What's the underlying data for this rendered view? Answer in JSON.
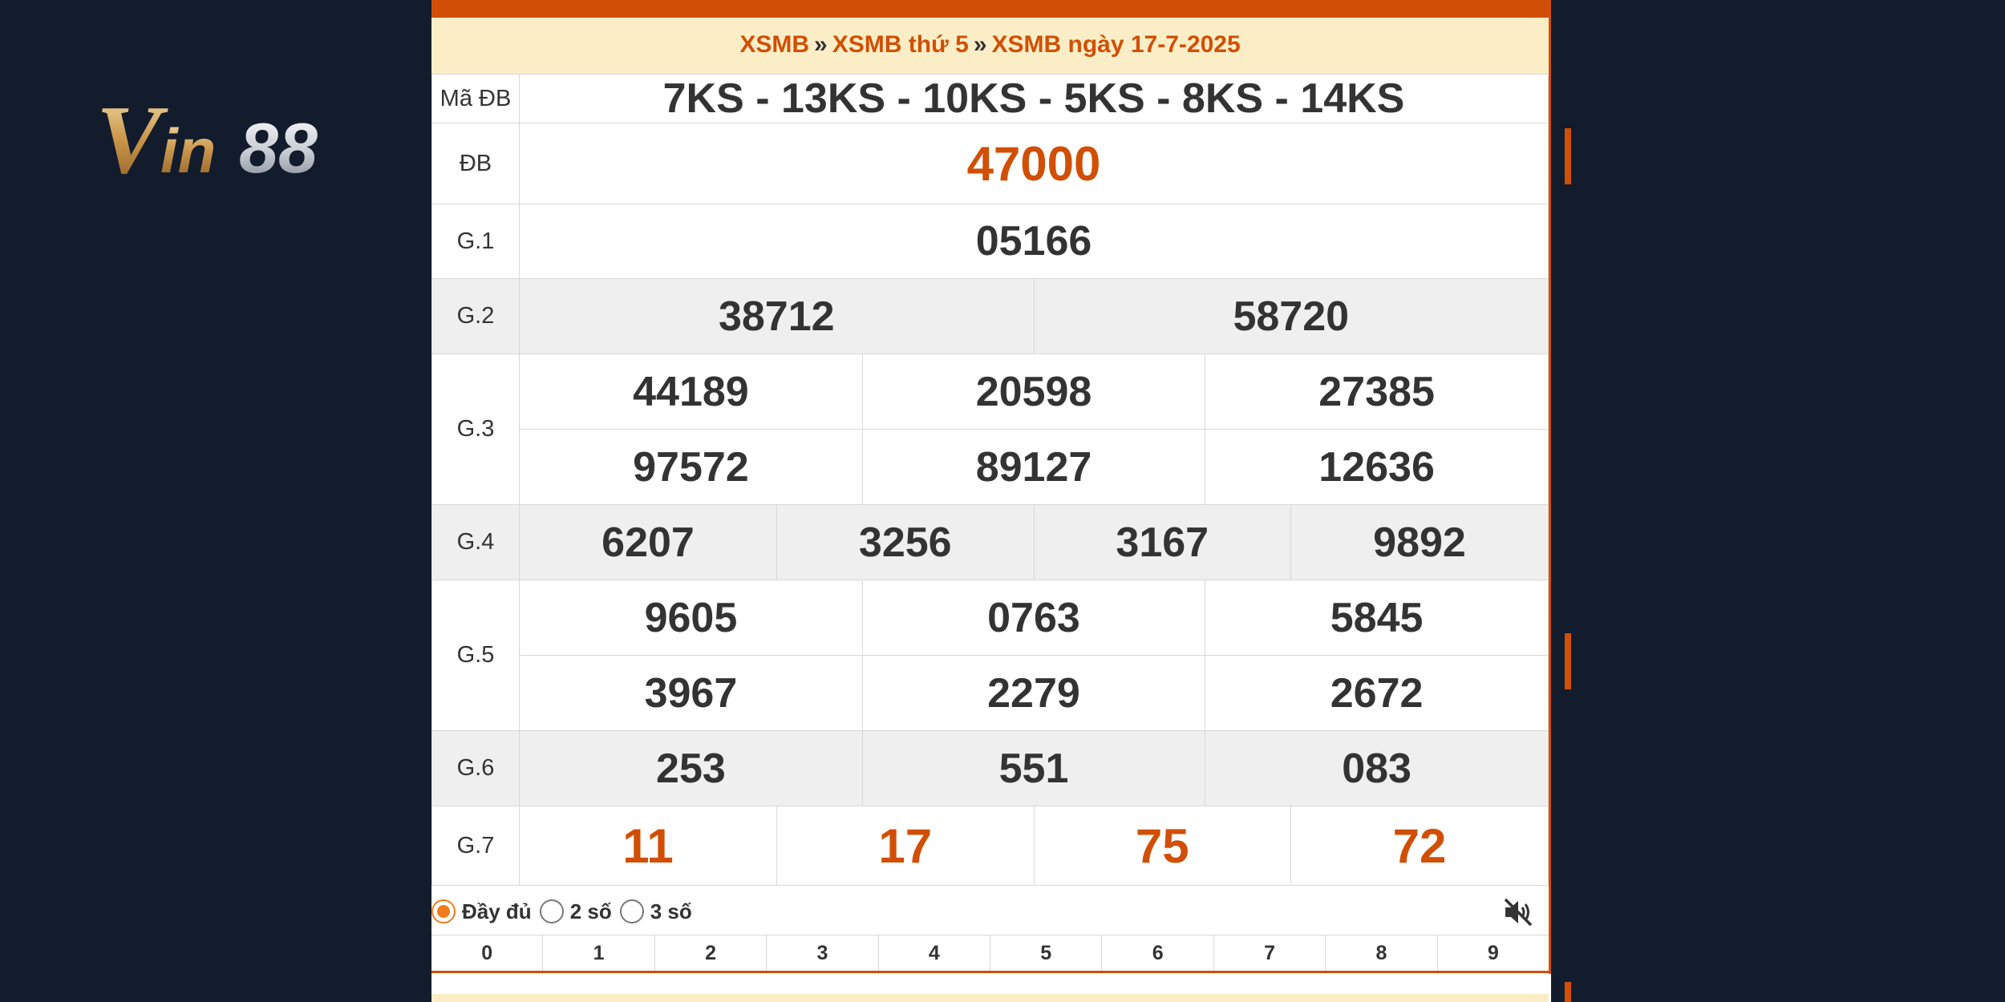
{
  "logo": {
    "text": "Vin88"
  },
  "breadcrumb": {
    "items": [
      "XSMB",
      "XSMB thứ 5",
      "XSMB ngày 17-7-2025"
    ],
    "separator": "»"
  },
  "results": {
    "code": {
      "label": "Mã ĐB",
      "value": "7KS - 13KS - 10KS - 5KS - 8KS - 14KS"
    },
    "db": {
      "label": "ĐB",
      "value": "47000"
    },
    "g1": {
      "label": "G.1",
      "values": [
        "05166"
      ]
    },
    "g2": {
      "label": "G.2",
      "values": [
        "38712",
        "58720"
      ]
    },
    "g3": {
      "label": "G.3",
      "values": [
        "44189",
        "20598",
        "27385",
        "97572",
        "89127",
        "12636"
      ]
    },
    "g4": {
      "label": "G.4",
      "values": [
        "6207",
        "3256",
        "3167",
        "9892"
      ]
    },
    "g5": {
      "label": "G.5",
      "values": [
        "9605",
        "0763",
        "5845",
        "3967",
        "2279",
        "2672"
      ]
    },
    "g6": {
      "label": "G.6",
      "values": [
        "253",
        "551",
        "083"
      ]
    },
    "g7": {
      "label": "G.7",
      "values": [
        "11",
        "17",
        "75",
        "72"
      ]
    }
  },
  "options": {
    "items": [
      "Đầy đủ",
      "2 số",
      "3 số"
    ],
    "selected": "Đầy đủ"
  },
  "mute_icon": "speaker-muted-icon",
  "digits": [
    "0",
    "1",
    "2",
    "3",
    "4",
    "5",
    "6",
    "7",
    "8",
    "9"
  ],
  "colors": {
    "accent": "#d14f04",
    "breadcrumb_bg": "#fbeec6",
    "code_blue": "#1a72c0",
    "background": "#131c2c"
  }
}
